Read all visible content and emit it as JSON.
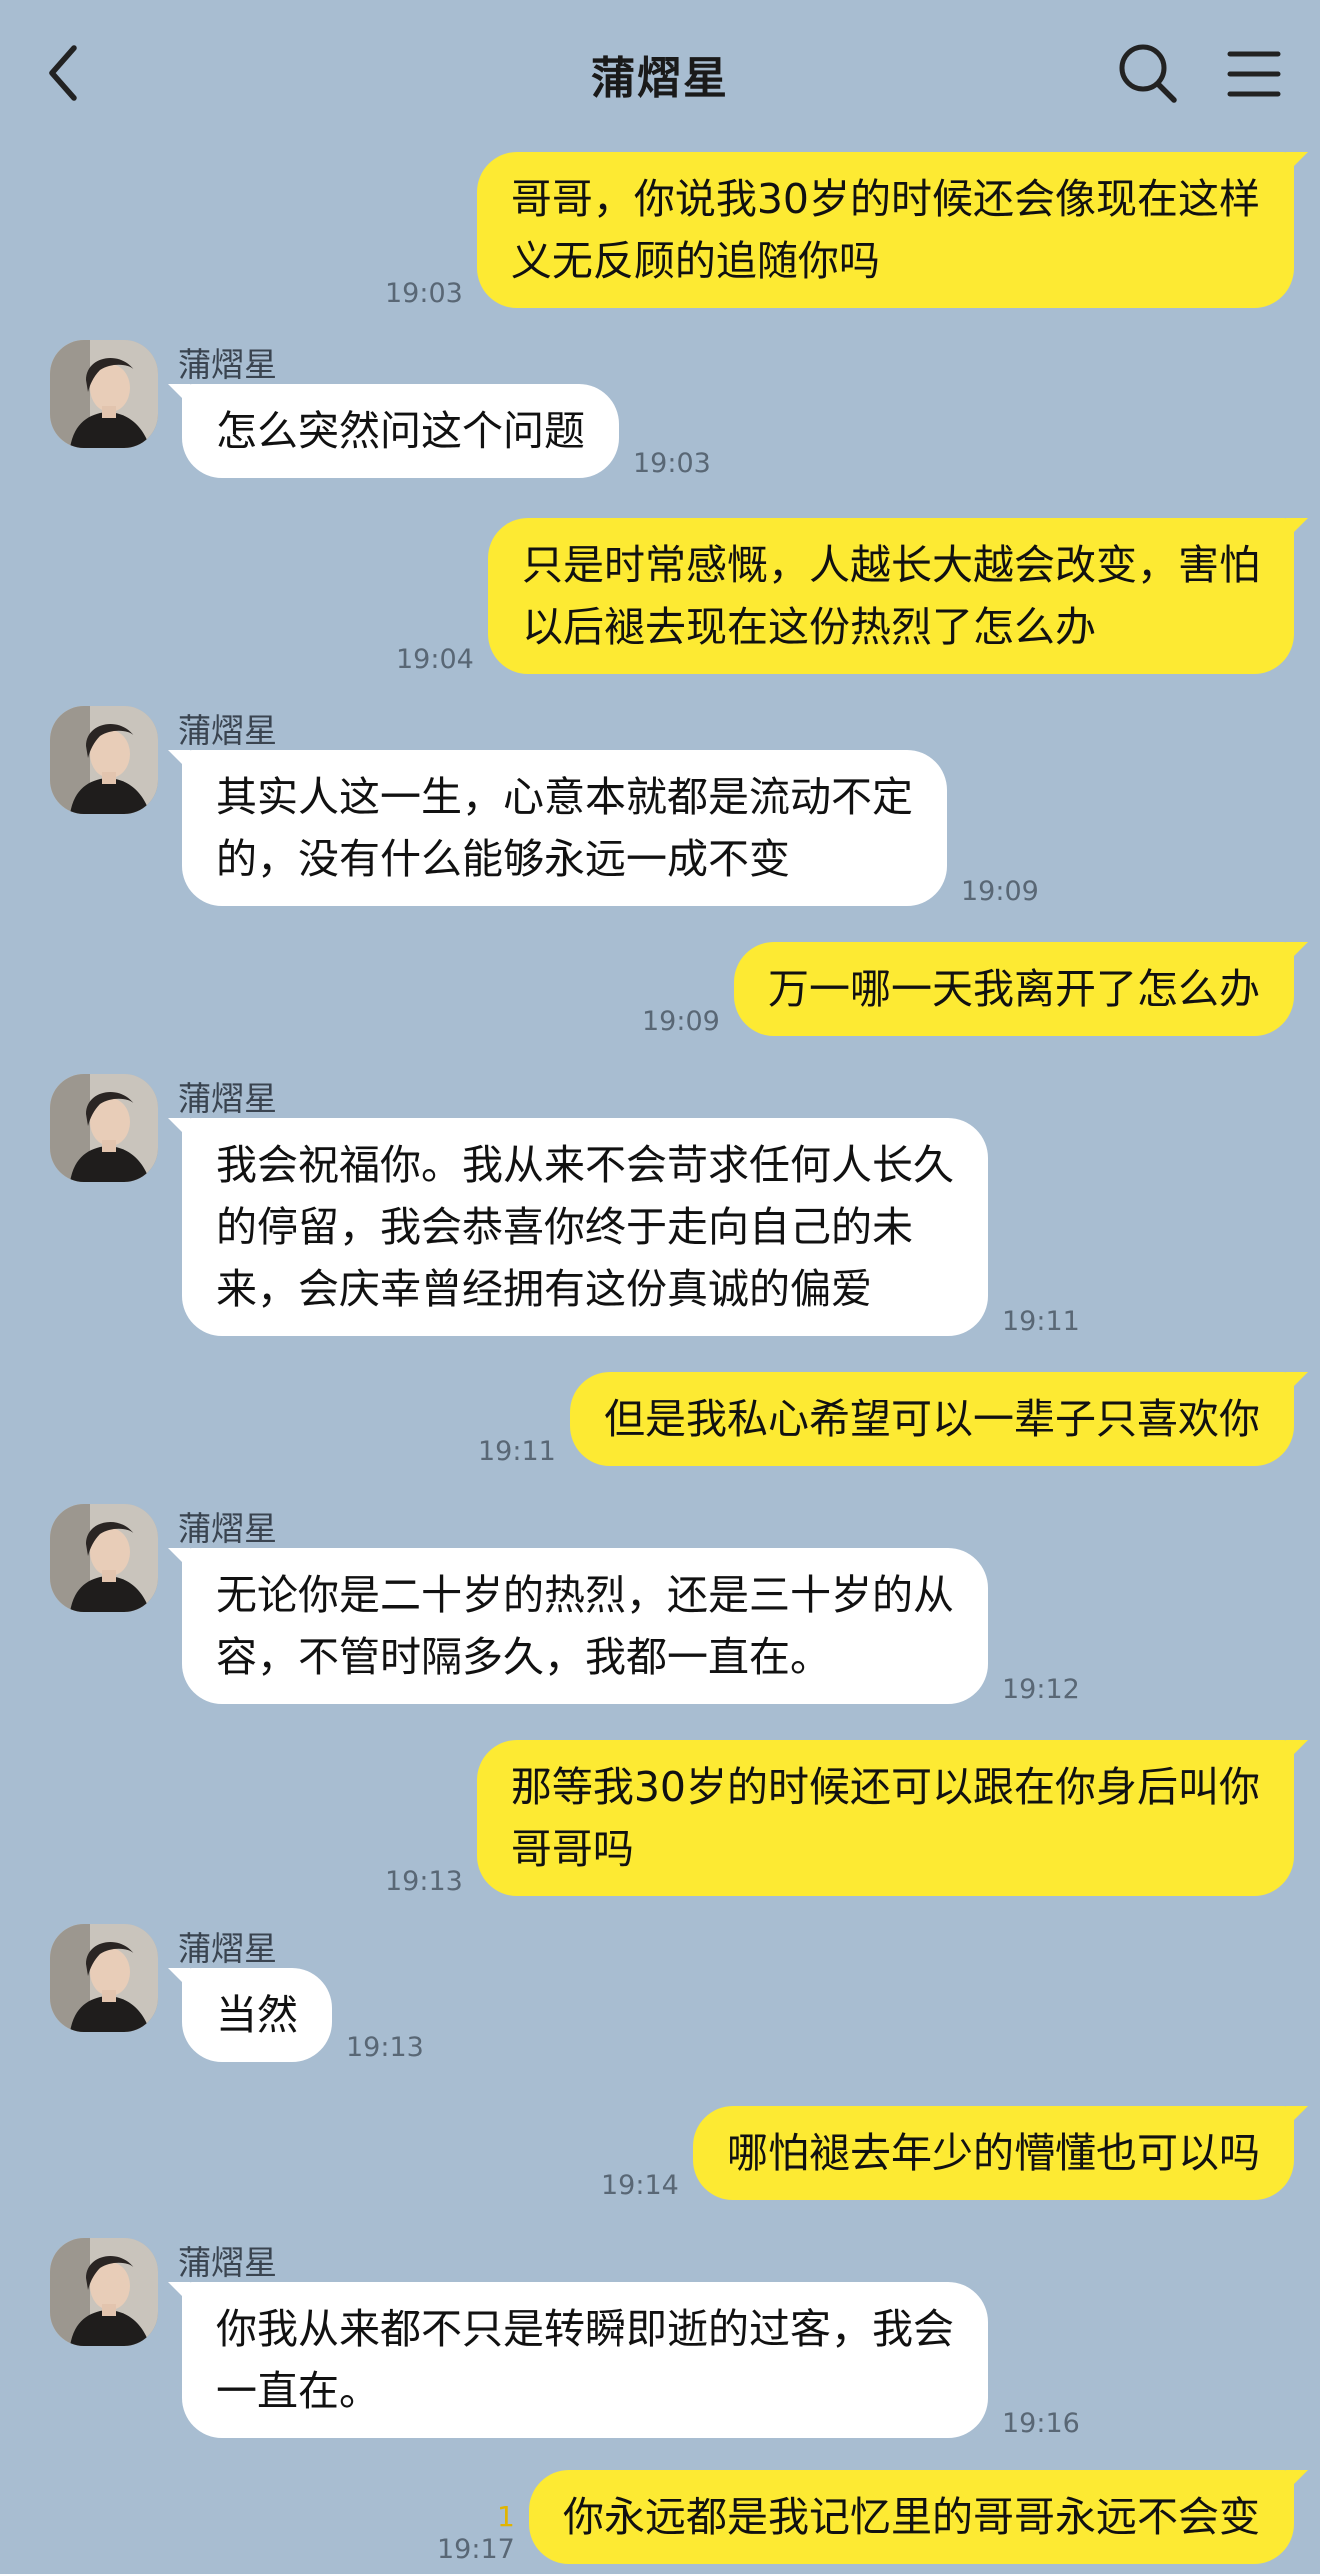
{
  "header": {
    "title": "蒲熠星"
  },
  "contact": {
    "name": "蒲熠星"
  },
  "messages": [
    {
      "dir": "out",
      "text": "哥哥，你说我30岁的时候还会像现在这样\n义无反顾的追随你吗",
      "time": "19:03"
    },
    {
      "dir": "in",
      "text": "怎么突然问这个问题",
      "time": "19:03"
    },
    {
      "dir": "out",
      "text": "只是时常感慨，人越长大越会改变，害怕\n以后褪去现在这份热烈了怎么办",
      "time": "19:04"
    },
    {
      "dir": "in",
      "text": "其实人这一生，心意本就都是流动不定\n的，没有什么能够永远一成不变",
      "time": "19:09"
    },
    {
      "dir": "out",
      "text": "万一哪一天我离开了怎么办",
      "time": "19:09"
    },
    {
      "dir": "in",
      "text": "我会祝福你。我从来不会苛求任何人长久\n的停留，我会恭喜你终于走向自己的未\n来，会庆幸曾经拥有这份真诚的偏爱",
      "time": "19:11"
    },
    {
      "dir": "out",
      "text": "但是我私心希望可以一辈子只喜欢你",
      "time": "19:11"
    },
    {
      "dir": "in",
      "text": "无论你是二十岁的热烈，还是三十岁的从\n容，不管时隔多久，我都一直在。",
      "time": "19:12"
    },
    {
      "dir": "out",
      "text": "那等我30岁的时候还可以跟在你身后叫你\n哥哥吗",
      "time": "19:13"
    },
    {
      "dir": "in",
      "text": "当然",
      "time": "19:13"
    },
    {
      "dir": "out",
      "text": "哪怕褪去年少的懵懂也可以吗",
      "time": "19:14"
    },
    {
      "dir": "in",
      "text": "你我从来都不只是转瞬即逝的过客，我会\n一直在。",
      "time": "19:16"
    },
    {
      "dir": "out",
      "text": "你永远都是我记忆里的哥哥永远不会变",
      "time": "19:17",
      "unread": "1"
    }
  ],
  "colors": {
    "background": "#a8bdd1",
    "outgoing": "#fdea33",
    "incoming": "#ffffff"
  },
  "icons": {
    "back": "chevron-left-icon",
    "search": "search-icon",
    "menu": "menu-icon"
  }
}
